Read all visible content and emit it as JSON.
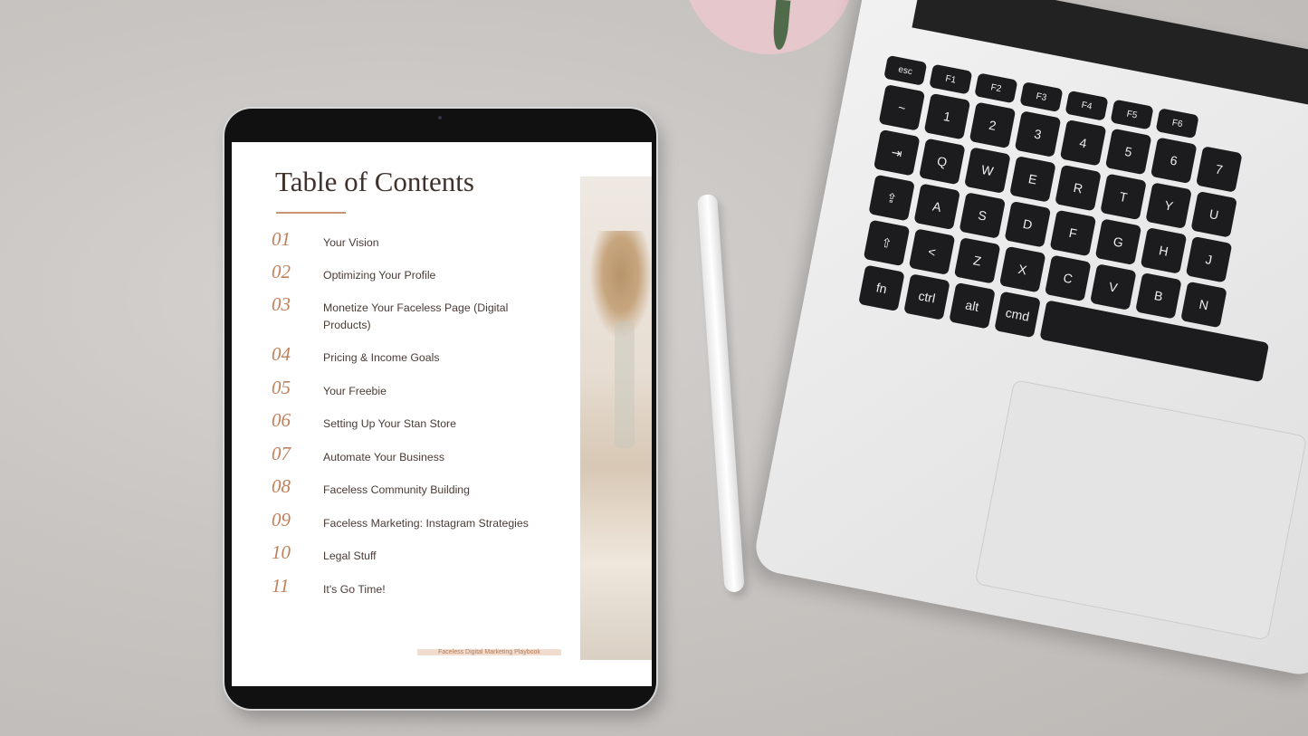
{
  "document": {
    "title": "Table of Contents",
    "items": [
      {
        "num": "01",
        "label": "Your Vision"
      },
      {
        "num": "02",
        "label": "Optimizing Your Profile"
      },
      {
        "num": "03",
        "label": "Monetize Your Faceless Page (Digital Products)"
      },
      {
        "num": "04",
        "label": "Pricing & Income Goals"
      },
      {
        "num": "05",
        "label": "Your Freebie"
      },
      {
        "num": "06",
        "label": "Setting Up Your Stan Store"
      },
      {
        "num": "07",
        "label": "Automate Your Business"
      },
      {
        "num": "08",
        "label": "Faceless Community Building"
      },
      {
        "num": "09",
        "label": "Faceless Marketing: Instagram Strategies"
      },
      {
        "num": "10",
        "label": "Legal Stuff"
      },
      {
        "num": "11",
        "label": "It's Go Time!"
      }
    ],
    "footer": "Faceless Digital Marketing Playbook",
    "accent_color": "#c0805a"
  },
  "keyboard": {
    "rows": [
      [
        "esc",
        "F1",
        "F2",
        "F3",
        "F4",
        "F5",
        "F6"
      ],
      [
        "~",
        "1",
        "2",
        "3",
        "4",
        "5",
        "6",
        "7"
      ],
      [
        "⇥",
        "Q",
        "W",
        "E",
        "R",
        "T",
        "Y",
        "U"
      ],
      [
        "⇪",
        "A",
        "S",
        "D",
        "F",
        "G",
        "H",
        "J"
      ],
      [
        "⇧",
        "<",
        "Z",
        "X",
        "C",
        "V",
        "B",
        "N"
      ],
      [
        "fn",
        "ctrl",
        "alt",
        "cmd"
      ]
    ]
  }
}
